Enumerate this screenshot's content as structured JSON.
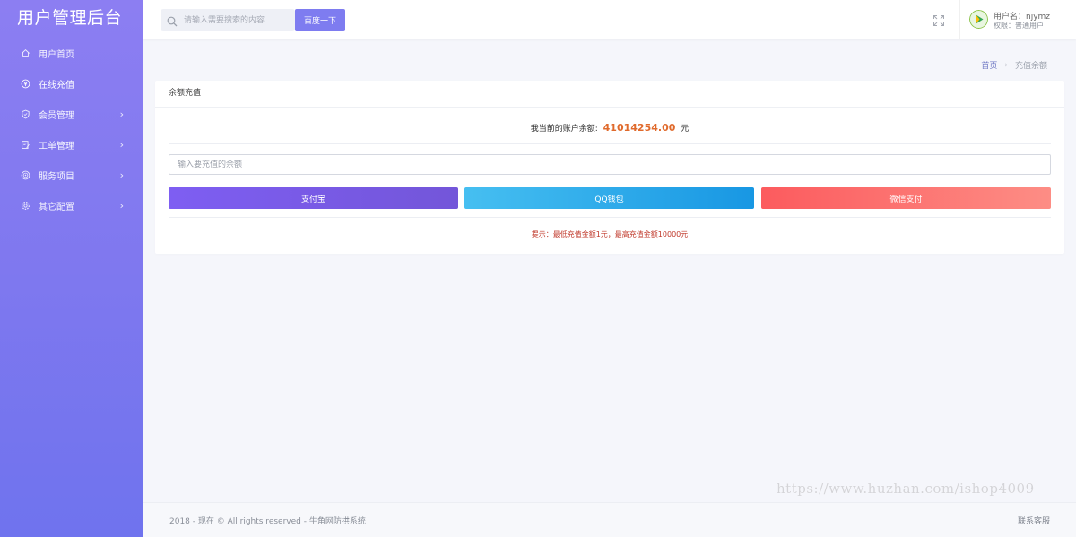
{
  "sidebar": {
    "brand": "用户管理后台",
    "items": [
      {
        "label": "用户首页",
        "icon": "home-icon"
      },
      {
        "label": "在线充值",
        "icon": "yen-icon"
      },
      {
        "label": "会员管理",
        "icon": "shield-icon"
      },
      {
        "label": "工单管理",
        "icon": "edit-icon"
      },
      {
        "label": "服务项目",
        "icon": "target-icon"
      },
      {
        "label": "其它配置",
        "icon": "gear-icon"
      }
    ]
  },
  "topbar": {
    "search_placeholder": "请输入需要搜索的内容",
    "search_button": "百度一下",
    "user_label": "用户名：njymz",
    "role_label": "权限：普通用户"
  },
  "breadcrumb": {
    "home": "首页",
    "current": "充值余额"
  },
  "card": {
    "title": "余额充值",
    "balance_label": "我当前的账户余额:",
    "balance_value": "41014254.00",
    "balance_unit": "元",
    "amount_placeholder": "输入要充值的余额",
    "alipay": "支付宝",
    "qq": "QQ钱包",
    "wechat": "微信支付",
    "tip": "提示：最低充值金额1元，最高充值金额10000元"
  },
  "footer": {
    "copyright": "2018 - 现在 © All rights reserved - 牛角网防拱系统",
    "contact": "联系客服"
  },
  "watermark": "https://www.huzhan.com/ishop4009",
  "colors": {
    "sidebar_top": "#8c7ef2",
    "sidebar_bottom": "#6f73ee",
    "accent": "#7e7cf0",
    "balance": "#e06a2c",
    "tip": "#c0392b"
  }
}
